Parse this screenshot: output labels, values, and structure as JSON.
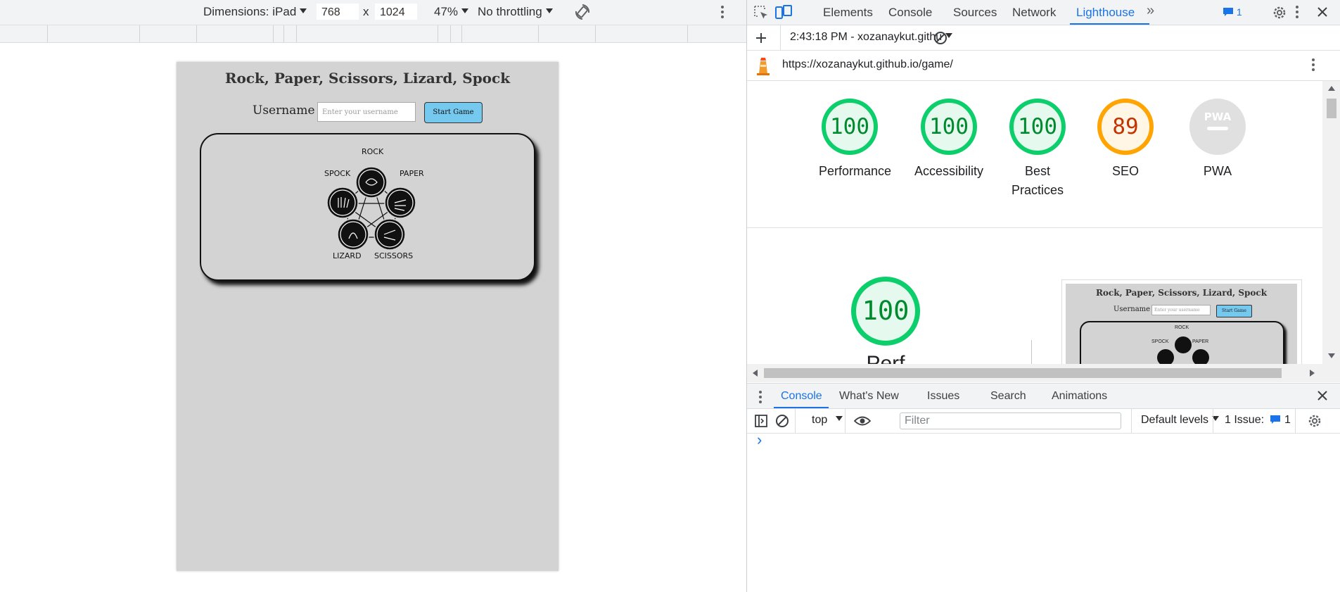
{
  "device_toolbar": {
    "dimensions_label": "Dimensions: iPad",
    "width": "768",
    "x": "x",
    "height": "1024",
    "zoom": "47%",
    "throttling": "No throttling"
  },
  "page": {
    "title": "Rock, Paper, Scissors, Lizard, Spock",
    "username_label": "Username",
    "username_placeholder": "Enter your username",
    "start_button": "Start Game",
    "diagram_labels": {
      "rock": "ROCK",
      "paper": "PAPER",
      "scissors": "SCISSORS",
      "lizard": "LIZARD",
      "spock": "SPOCK"
    }
  },
  "devtools": {
    "tabs": [
      "Elements",
      "Console",
      "Sources",
      "Network",
      "Lighthouse"
    ],
    "active_tab": "Lighthouse",
    "issues_badge": "1",
    "report_time": "2:43:18 PM - xozanaykut.githu",
    "url": "https://xozanaykut.github.io/game/",
    "scores": [
      {
        "label": "Performance",
        "value": "100",
        "color": "#0cce6b"
      },
      {
        "label": "Accessibility",
        "value": "100",
        "color": "#0cce6b"
      },
      {
        "label": "Best Practices",
        "value": "100",
        "color": "#0cce6b"
      },
      {
        "label": "SEO",
        "value": "89",
        "color": "#ffa400"
      },
      {
        "label": "PWA",
        "value": "PWA",
        "color": "#cccccc"
      }
    ],
    "big_score": "100",
    "big_score_label_partial": "Perf",
    "thumbnail": {
      "title": "Rock, Paper, Scissors, Lizard, Spock",
      "username_label": "Username",
      "placeholder": "Enter your username",
      "start_button": "Start Game",
      "rock": "ROCK",
      "spock": "SPOCK",
      "paper": "PAPER"
    }
  },
  "drawer": {
    "tabs": [
      "Console",
      "What's New",
      "Issues",
      "Search",
      "Animations"
    ],
    "active_tab": "Console",
    "context": "top",
    "filter_placeholder": "Filter",
    "levels": "Default levels",
    "issues_label": "1 Issue:",
    "issues_count": "1",
    "prompt": "›"
  },
  "colors": {
    "accent": "#1a73e8",
    "pass": "#0cce6b",
    "average": "#ffa400",
    "button": "#75c8ee",
    "page_bg": "#d3d3d3"
  }
}
